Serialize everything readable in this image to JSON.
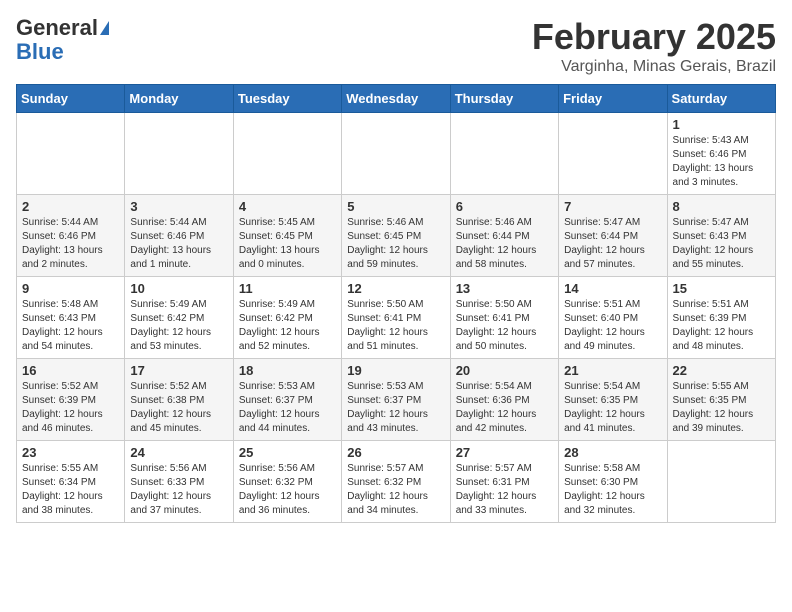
{
  "header": {
    "logo_general": "General",
    "logo_blue": "Blue",
    "month_title": "February 2025",
    "location": "Varginha, Minas Gerais, Brazil"
  },
  "weekdays": [
    "Sunday",
    "Monday",
    "Tuesday",
    "Wednesday",
    "Thursday",
    "Friday",
    "Saturday"
  ],
  "weeks": [
    [
      {
        "day": "",
        "info": ""
      },
      {
        "day": "",
        "info": ""
      },
      {
        "day": "",
        "info": ""
      },
      {
        "day": "",
        "info": ""
      },
      {
        "day": "",
        "info": ""
      },
      {
        "day": "",
        "info": ""
      },
      {
        "day": "1",
        "info": "Sunrise: 5:43 AM\nSunset: 6:46 PM\nDaylight: 13 hours\nand 3 minutes."
      }
    ],
    [
      {
        "day": "2",
        "info": "Sunrise: 5:44 AM\nSunset: 6:46 PM\nDaylight: 13 hours\nand 2 minutes."
      },
      {
        "day": "3",
        "info": "Sunrise: 5:44 AM\nSunset: 6:46 PM\nDaylight: 13 hours\nand 1 minute."
      },
      {
        "day": "4",
        "info": "Sunrise: 5:45 AM\nSunset: 6:45 PM\nDaylight: 13 hours\nand 0 minutes."
      },
      {
        "day": "5",
        "info": "Sunrise: 5:46 AM\nSunset: 6:45 PM\nDaylight: 12 hours\nand 59 minutes."
      },
      {
        "day": "6",
        "info": "Sunrise: 5:46 AM\nSunset: 6:44 PM\nDaylight: 12 hours\nand 58 minutes."
      },
      {
        "day": "7",
        "info": "Sunrise: 5:47 AM\nSunset: 6:44 PM\nDaylight: 12 hours\nand 57 minutes."
      },
      {
        "day": "8",
        "info": "Sunrise: 5:47 AM\nSunset: 6:43 PM\nDaylight: 12 hours\nand 55 minutes."
      }
    ],
    [
      {
        "day": "9",
        "info": "Sunrise: 5:48 AM\nSunset: 6:43 PM\nDaylight: 12 hours\nand 54 minutes."
      },
      {
        "day": "10",
        "info": "Sunrise: 5:49 AM\nSunset: 6:42 PM\nDaylight: 12 hours\nand 53 minutes."
      },
      {
        "day": "11",
        "info": "Sunrise: 5:49 AM\nSunset: 6:42 PM\nDaylight: 12 hours\nand 52 minutes."
      },
      {
        "day": "12",
        "info": "Sunrise: 5:50 AM\nSunset: 6:41 PM\nDaylight: 12 hours\nand 51 minutes."
      },
      {
        "day": "13",
        "info": "Sunrise: 5:50 AM\nSunset: 6:41 PM\nDaylight: 12 hours\nand 50 minutes."
      },
      {
        "day": "14",
        "info": "Sunrise: 5:51 AM\nSunset: 6:40 PM\nDaylight: 12 hours\nand 49 minutes."
      },
      {
        "day": "15",
        "info": "Sunrise: 5:51 AM\nSunset: 6:39 PM\nDaylight: 12 hours\nand 48 minutes."
      }
    ],
    [
      {
        "day": "16",
        "info": "Sunrise: 5:52 AM\nSunset: 6:39 PM\nDaylight: 12 hours\nand 46 minutes."
      },
      {
        "day": "17",
        "info": "Sunrise: 5:52 AM\nSunset: 6:38 PM\nDaylight: 12 hours\nand 45 minutes."
      },
      {
        "day": "18",
        "info": "Sunrise: 5:53 AM\nSunset: 6:37 PM\nDaylight: 12 hours\nand 44 minutes."
      },
      {
        "day": "19",
        "info": "Sunrise: 5:53 AM\nSunset: 6:37 PM\nDaylight: 12 hours\nand 43 minutes."
      },
      {
        "day": "20",
        "info": "Sunrise: 5:54 AM\nSunset: 6:36 PM\nDaylight: 12 hours\nand 42 minutes."
      },
      {
        "day": "21",
        "info": "Sunrise: 5:54 AM\nSunset: 6:35 PM\nDaylight: 12 hours\nand 41 minutes."
      },
      {
        "day": "22",
        "info": "Sunrise: 5:55 AM\nSunset: 6:35 PM\nDaylight: 12 hours\nand 39 minutes."
      }
    ],
    [
      {
        "day": "23",
        "info": "Sunrise: 5:55 AM\nSunset: 6:34 PM\nDaylight: 12 hours\nand 38 minutes."
      },
      {
        "day": "24",
        "info": "Sunrise: 5:56 AM\nSunset: 6:33 PM\nDaylight: 12 hours\nand 37 minutes."
      },
      {
        "day": "25",
        "info": "Sunrise: 5:56 AM\nSunset: 6:32 PM\nDaylight: 12 hours\nand 36 minutes."
      },
      {
        "day": "26",
        "info": "Sunrise: 5:57 AM\nSunset: 6:32 PM\nDaylight: 12 hours\nand 34 minutes."
      },
      {
        "day": "27",
        "info": "Sunrise: 5:57 AM\nSunset: 6:31 PM\nDaylight: 12 hours\nand 33 minutes."
      },
      {
        "day": "28",
        "info": "Sunrise: 5:58 AM\nSunset: 6:30 PM\nDaylight: 12 hours\nand 32 minutes."
      },
      {
        "day": "",
        "info": ""
      }
    ]
  ]
}
